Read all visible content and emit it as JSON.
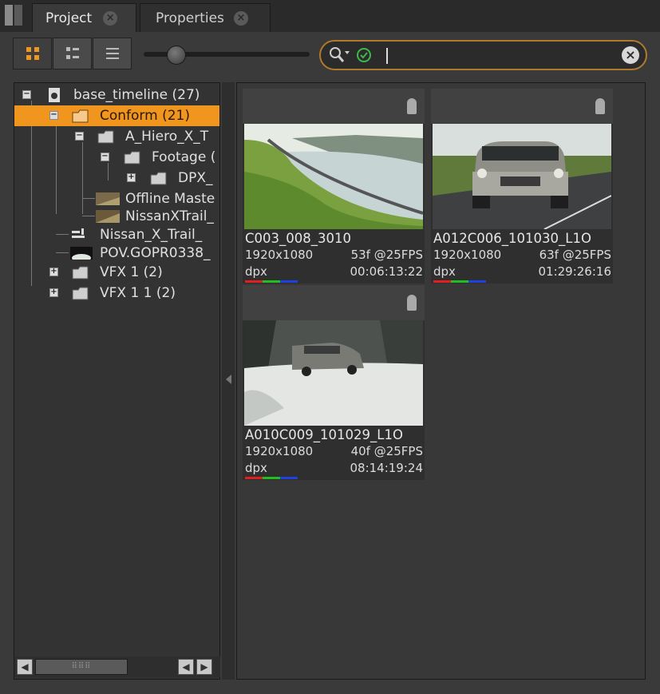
{
  "tabs": [
    {
      "label": "Project",
      "active": true
    },
    {
      "label": "Properties",
      "active": false
    }
  ],
  "toolbar": {
    "view_modes": [
      "grid-view-icon",
      "thumbnail-list-icon",
      "list-view-icon"
    ],
    "selected_view": "grid-view-icon",
    "thumbnail_size_fraction": 0.16
  },
  "search": {
    "value": "",
    "icons": [
      "search-filter-icon",
      "check-circle-icon",
      "clear-icon"
    ]
  },
  "tree": {
    "items": [
      {
        "label": "base_timeline (27)",
        "icon": "sequence-icon",
        "expander": "-"
      },
      {
        "label": "Conform (21)",
        "icon": "folder-icon",
        "expander": "-",
        "selected": true
      },
      {
        "label": "A_Hiero_X_T",
        "icon": "folder-icon",
        "expander": "-"
      },
      {
        "label": "Footage (",
        "icon": "folder-icon",
        "expander": "-"
      },
      {
        "label": "DPX_",
        "icon": "folder-icon",
        "expander": "+"
      },
      {
        "label": "Offline Maste",
        "icon": "clip-icon"
      },
      {
        "label": "NissanXTrail_",
        "icon": "clip-icon"
      },
      {
        "label": "Nissan_X_Trail_",
        "icon": "timeline-icon"
      },
      {
        "label": "POV.GOPR0338_",
        "icon": "clip-icon"
      },
      {
        "label": "VFX 1 (2)",
        "icon": "folder-icon",
        "expander": "+"
      },
      {
        "label": "VFX 1 1 (2)",
        "icon": "folder-icon",
        "expander": "+"
      }
    ]
  },
  "clips": [
    {
      "name": "C003_008_3010",
      "resolution": "1920x1080",
      "frames": "53f @25FPS",
      "format": "dpx",
      "timecode": "00:06:13:22",
      "thumb": "coastline-road"
    },
    {
      "name": "A012C006_101030_L1O",
      "resolution": "1920x1080",
      "frames": "63f @25FPS",
      "format": "dpx",
      "timecode": "01:29:26:16",
      "thumb": "suv-on-road"
    },
    {
      "name": "A010C009_101029_L1O",
      "resolution": "1920x1080",
      "frames": "40f @25FPS",
      "format": "dpx",
      "timecode": "08:14:19:24",
      "thumb": "suv-in-snow"
    }
  ],
  "colors": {
    "accent": "#f0951e",
    "search_border": "#b07a2a",
    "rgb": [
      "#e02020",
      "#20c020",
      "#2040e0"
    ]
  }
}
